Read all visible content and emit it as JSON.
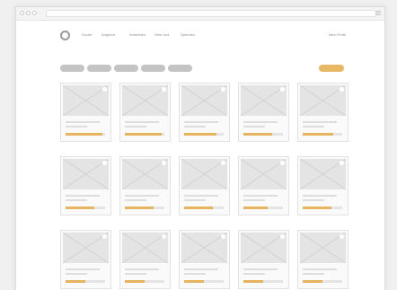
{
  "window": {
    "titlebar_dots": [
      "dot-1",
      "dot-2",
      "dot-3"
    ]
  },
  "header": {
    "logo_icon": "circle-logo-icon",
    "nav": [
      "Suche",
      "Angebot",
      "Anmelden",
      "Über uns",
      "Spenden"
    ],
    "signin": "Mein Profil"
  },
  "filters": {
    "chips": [
      "filter-1",
      "filter-2",
      "filter-3",
      "filter-4",
      "filter-5"
    ],
    "cta_color": "#e9b866"
  },
  "colors": {
    "accent": "#e6b35e",
    "placeholder": "#e4e4e4"
  },
  "grid": {
    "rows": [
      [
        {
          "rating": 0.93
        },
        {
          "rating": 0.93
        },
        {
          "rating": 0.82
        },
        {
          "rating": 0.72
        },
        {
          "rating": 0.78
        }
      ],
      [
        {
          "rating": 0.72
        },
        {
          "rating": 0.72
        },
        {
          "rating": 0.72
        },
        {
          "rating": 0.62
        },
        {
          "rating": 0.72
        }
      ],
      [
        {
          "rating": 0.5
        },
        {
          "rating": 0.5
        },
        {
          "rating": 0.5
        },
        {
          "rating": 0.5
        },
        {
          "rating": 0.5
        }
      ]
    ]
  }
}
